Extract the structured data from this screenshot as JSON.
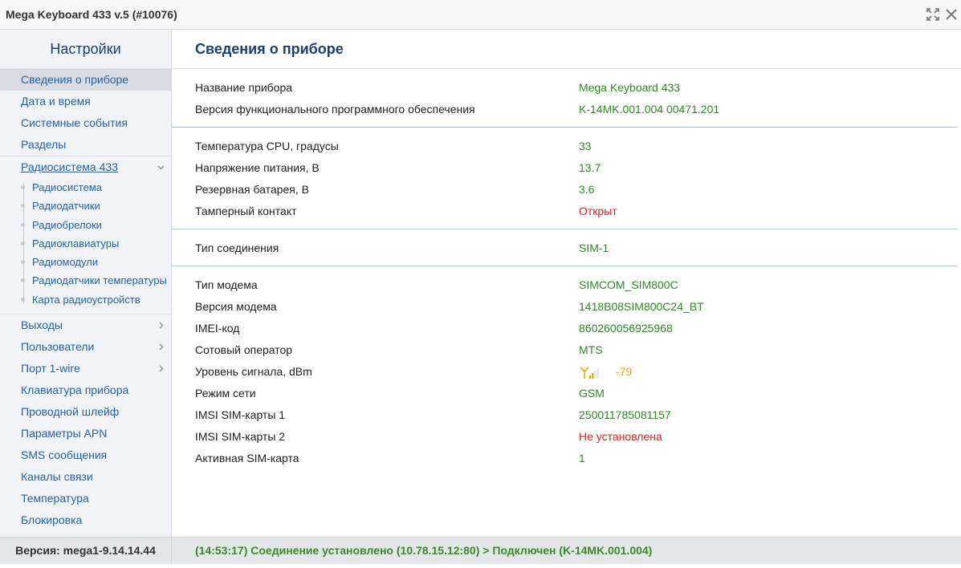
{
  "window": {
    "title": "Mega Keyboard 433 v.5 (#10076)",
    "icons": [
      "expand-icon",
      "close-icon"
    ]
  },
  "sidebar": {
    "header": "Настройки",
    "items_top": [
      {
        "label": "Сведения о приборе",
        "active": true
      },
      {
        "label": "Дата и время"
      },
      {
        "label": "Системные события"
      },
      {
        "label": "Разделы"
      }
    ],
    "radio": {
      "label": "Радиосистема 433",
      "expanded": true,
      "children": [
        "Радиосистема",
        "Радиодатчики",
        "Радиобрелоки",
        "Радиоклавиатуры",
        "Радиомодули",
        "Радиодатчики температуры",
        "Карта радиоустройств"
      ]
    },
    "items_bottom": [
      {
        "label": "Выходы",
        "chevron": true
      },
      {
        "label": "Пользователи",
        "chevron": true
      },
      {
        "label": "Порт 1-wire",
        "chevron": true
      },
      {
        "label": "Клавиатура прибора"
      },
      {
        "label": "Проводной шлейф"
      },
      {
        "label": "Параметры APN"
      },
      {
        "label": "SMS сообщения"
      },
      {
        "label": "Каналы связи"
      },
      {
        "label": "Температура"
      },
      {
        "label": "Блокировка"
      }
    ]
  },
  "main": {
    "title": "Сведения о приборе",
    "sections": [
      [
        {
          "label": "Название прибора",
          "value": "Mega Keyboard 433",
          "color": "#2e8b24"
        },
        {
          "label": "Версия функционального программного обеспечения",
          "value": "K-14MK.001.004 00471.201",
          "color": "#2e8b24"
        }
      ],
      [
        {
          "label": "Температура CPU, градусы",
          "value": "33",
          "color": "#2e8b24"
        },
        {
          "label": "Напряжение питания, В",
          "value": "13.7",
          "color": "#2e8b24"
        },
        {
          "label": "Резервная батарея, В",
          "value": "3.6",
          "color": "#2e8b24"
        },
        {
          "label": "Тамперный контакт",
          "value": "Открыт",
          "color": "#e02020"
        }
      ],
      [
        {
          "label": "Тип соединения",
          "value": "SIM-1",
          "color": "#2e8b24"
        }
      ],
      [
        {
          "label": "Тип модема",
          "value": "SIMCOM_SIM800C",
          "color": "#2e8b24"
        },
        {
          "label": "Версия модема",
          "value": "1418B08SIM800C24_BT",
          "color": "#2e8b24"
        },
        {
          "label": "IMEI-код",
          "value": "860260056925968",
          "color": "#2e8b24"
        },
        {
          "label": "Сотовый оператор",
          "value": "MTS",
          "color": "#2e8b24"
        },
        {
          "label": "Уровень сигнала, dBm",
          "value": "-79",
          "color": "#e6a700",
          "icon": "signal-icon",
          "signal_bars": 2
        },
        {
          "label": "Режим сети",
          "value": "GSM",
          "color": "#2e8b24"
        },
        {
          "label": "IMSI SIM-карты 1",
          "value": "250011785081157",
          "color": "#2e8b24"
        },
        {
          "label": "IMSI SIM-карты 2",
          "value": "Не установлена",
          "color": "#e02020"
        },
        {
          "label": "Активная SIM-карта",
          "value": "1",
          "color": "#2e8b24"
        }
      ]
    ]
  },
  "footer": {
    "version": "Версия: mega1-9.14.14.44",
    "status": "(14:53:17) Соединение установлено (10.78.15.12:80) > Подключен (K-14MK.001.004)"
  },
  "colors": {
    "link": "#1f63b0",
    "heading": "#1d3f71",
    "ok": "#2e8b24",
    "error": "#e02020",
    "warning": "#e6a700"
  }
}
